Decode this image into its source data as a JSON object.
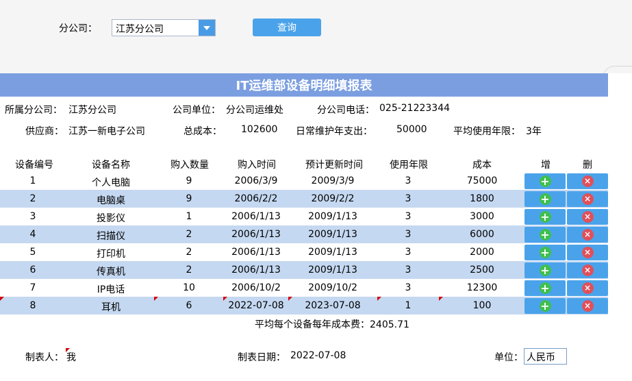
{
  "filter": {
    "label": "分公司：",
    "selected": "江苏分公司",
    "query_label": "查询"
  },
  "report": {
    "title": "IT运维部设备明细填报表"
  },
  "info": {
    "branch_label": "所属分公司：",
    "branch_value": "江苏分公司",
    "unit_label": "公司单位：",
    "unit_value": "分公司运维处",
    "phone_label": "分公司电话：",
    "phone_value": "025-21223344",
    "supplier_label": "供应商：",
    "supplier_value": "江苏一新电子公司",
    "total_cost_label": "总成本：",
    "total_cost_value": "102600",
    "maintenance_label": "日常维护年支出：",
    "maintenance_value": "50000",
    "avg_years_label": "平均使用年限：",
    "avg_years_value": "3年"
  },
  "table": {
    "headers": [
      "设备编号",
      "设备名称",
      "购入数量",
      "购入时间",
      "预计更新时间",
      "使用年限",
      "成本",
      "增",
      "删"
    ],
    "rows": [
      {
        "id": "1",
        "name": "个人电脑",
        "qty": "9",
        "buy": "2006/3/9",
        "renew": "2009/3/9",
        "years": "3",
        "cost": "75000"
      },
      {
        "id": "2",
        "name": "电脑桌",
        "qty": "9",
        "buy": "2006/2/2",
        "renew": "2009/2/2",
        "years": "3",
        "cost": "1800"
      },
      {
        "id": "3",
        "name": "投影仪",
        "qty": "1",
        "buy": "2006/1/13",
        "renew": "2009/1/13",
        "years": "3",
        "cost": "3000"
      },
      {
        "id": "4",
        "name": "扫描仪",
        "qty": "2",
        "buy": "2006/1/13",
        "renew": "2009/1/13",
        "years": "3",
        "cost": "6000"
      },
      {
        "id": "5",
        "name": "打印机",
        "qty": "2",
        "buy": "2006/1/13",
        "renew": "2009/1/13",
        "years": "3",
        "cost": "2000"
      },
      {
        "id": "6",
        "name": "传真机",
        "qty": "2",
        "buy": "2006/1/13",
        "renew": "2009/1/13",
        "years": "3",
        "cost": "2500"
      },
      {
        "id": "7",
        "name": "IP电话",
        "qty": "10",
        "buy": "2006/10/2",
        "renew": "2009/10/2",
        "years": "3",
        "cost": "12300"
      },
      {
        "id": "8",
        "name": "耳机",
        "qty": "6",
        "buy": "2022-07-08",
        "renew": "2023-07-08",
        "years": "1",
        "cost": "100"
      }
    ]
  },
  "summary": {
    "label": "平均每个设备每年成本费：",
    "value": "2405.71"
  },
  "footer": {
    "maker_label": "制表人：",
    "maker_value": "我",
    "date_label": "制表日期：",
    "date_value": "2022-07-08",
    "unit_label": "单位：",
    "unit_value": "人民币"
  },
  "icons": {
    "add": "+",
    "delete": "×"
  },
  "colors": {
    "title_bar": "#7b9ee0",
    "row_alt": "#c5d8f1",
    "button": "#4aa3ea",
    "add_icon": "#3fbf4f",
    "delete_icon": "#e0505a"
  }
}
